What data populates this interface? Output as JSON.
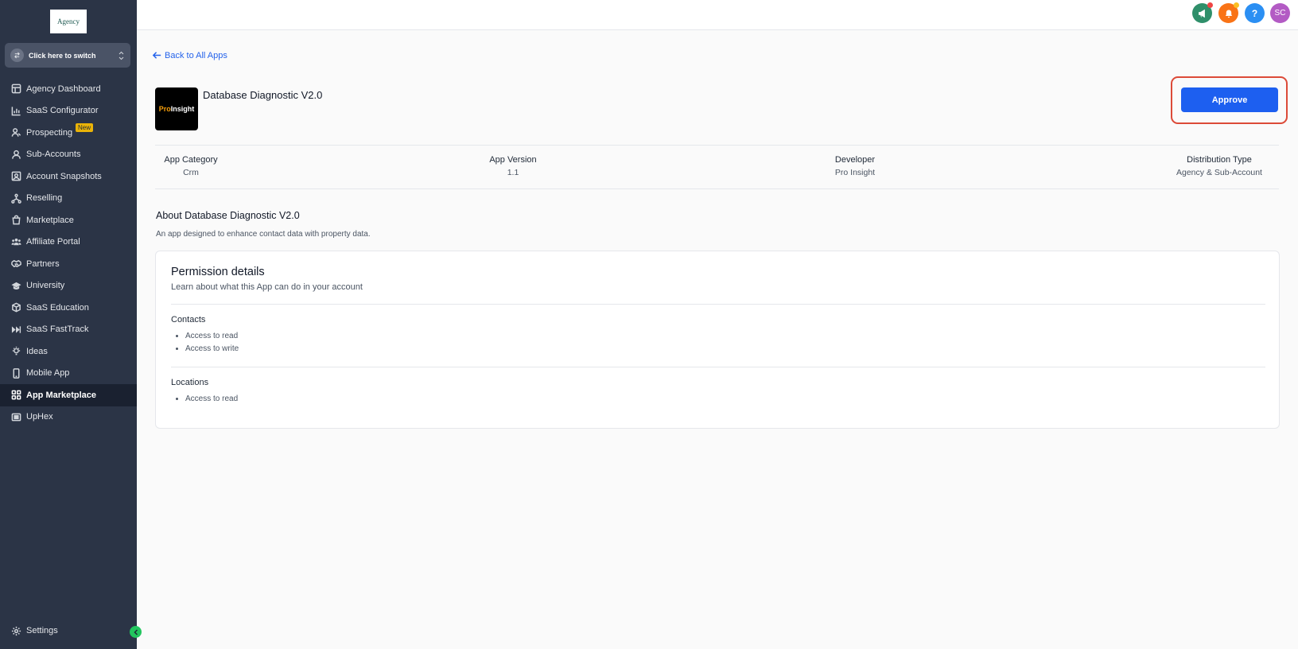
{
  "sidebar": {
    "logo_text": "Agency",
    "switcher_label": "Click here to switch",
    "items": [
      {
        "label": "Agency Dashboard",
        "icon": "dashboard-icon"
      },
      {
        "label": "SaaS Configurator",
        "icon": "bar-chart-icon"
      },
      {
        "label": "Prospecting",
        "icon": "prospecting-icon",
        "badge": "New"
      },
      {
        "label": "Sub-Accounts",
        "icon": "user-icon"
      },
      {
        "label": "Account Snapshots",
        "icon": "snapshot-icon"
      },
      {
        "label": "Reselling",
        "icon": "reselling-icon"
      },
      {
        "label": "Marketplace",
        "icon": "shopping-bag-icon"
      },
      {
        "label": "Affiliate Portal",
        "icon": "users-icon"
      },
      {
        "label": "Partners",
        "icon": "handshake-icon"
      },
      {
        "label": "University",
        "icon": "graduation-cap-icon"
      },
      {
        "label": "SaaS Education",
        "icon": "box-icon"
      },
      {
        "label": "SaaS FastTrack",
        "icon": "fast-forward-icon"
      },
      {
        "label": "Ideas",
        "icon": "lightbulb-icon"
      },
      {
        "label": "Mobile App",
        "icon": "mobile-icon"
      },
      {
        "label": "App Marketplace",
        "icon": "grid-icon",
        "active": true
      },
      {
        "label": "UpHex",
        "icon": "uphex-icon"
      }
    ],
    "settings_label": "Settings"
  },
  "topbar": {
    "avatar_initials": "SC",
    "help_label": "?",
    "colors": {
      "announce": "#2f8f6a",
      "notify": "#f97316",
      "help": "#2b8ff3",
      "avatar": "#b35bc4"
    }
  },
  "main": {
    "back_label": "Back to All Apps",
    "app_logo_text_1": "Pro",
    "app_logo_text_2": "Insight",
    "app_title": "Database Diagnostic V2.0",
    "approve_label": "Approve",
    "meta": [
      {
        "label": "App Category",
        "value": "Crm"
      },
      {
        "label": "App Version",
        "value": "1.1"
      },
      {
        "label": "Developer",
        "value": "Pro Insight"
      },
      {
        "label": "Distribution Type",
        "value": "Agency & Sub-Account"
      }
    ],
    "about_title": "About Database Diagnostic V2.0",
    "about_desc": "An app designed to enhance contact data with property data.",
    "permissions": {
      "title": "Permission details",
      "subtitle": "Learn about what this App can do in your account",
      "sections": [
        {
          "name": "Contacts",
          "items": [
            "Access to read",
            "Access to write"
          ]
        },
        {
          "name": "Locations",
          "items": [
            "Access to read"
          ]
        }
      ]
    }
  },
  "colors": {
    "accent": "#1d5ff0",
    "sidebar_bg": "#2b3446",
    "highlight": "#dc4a38"
  }
}
